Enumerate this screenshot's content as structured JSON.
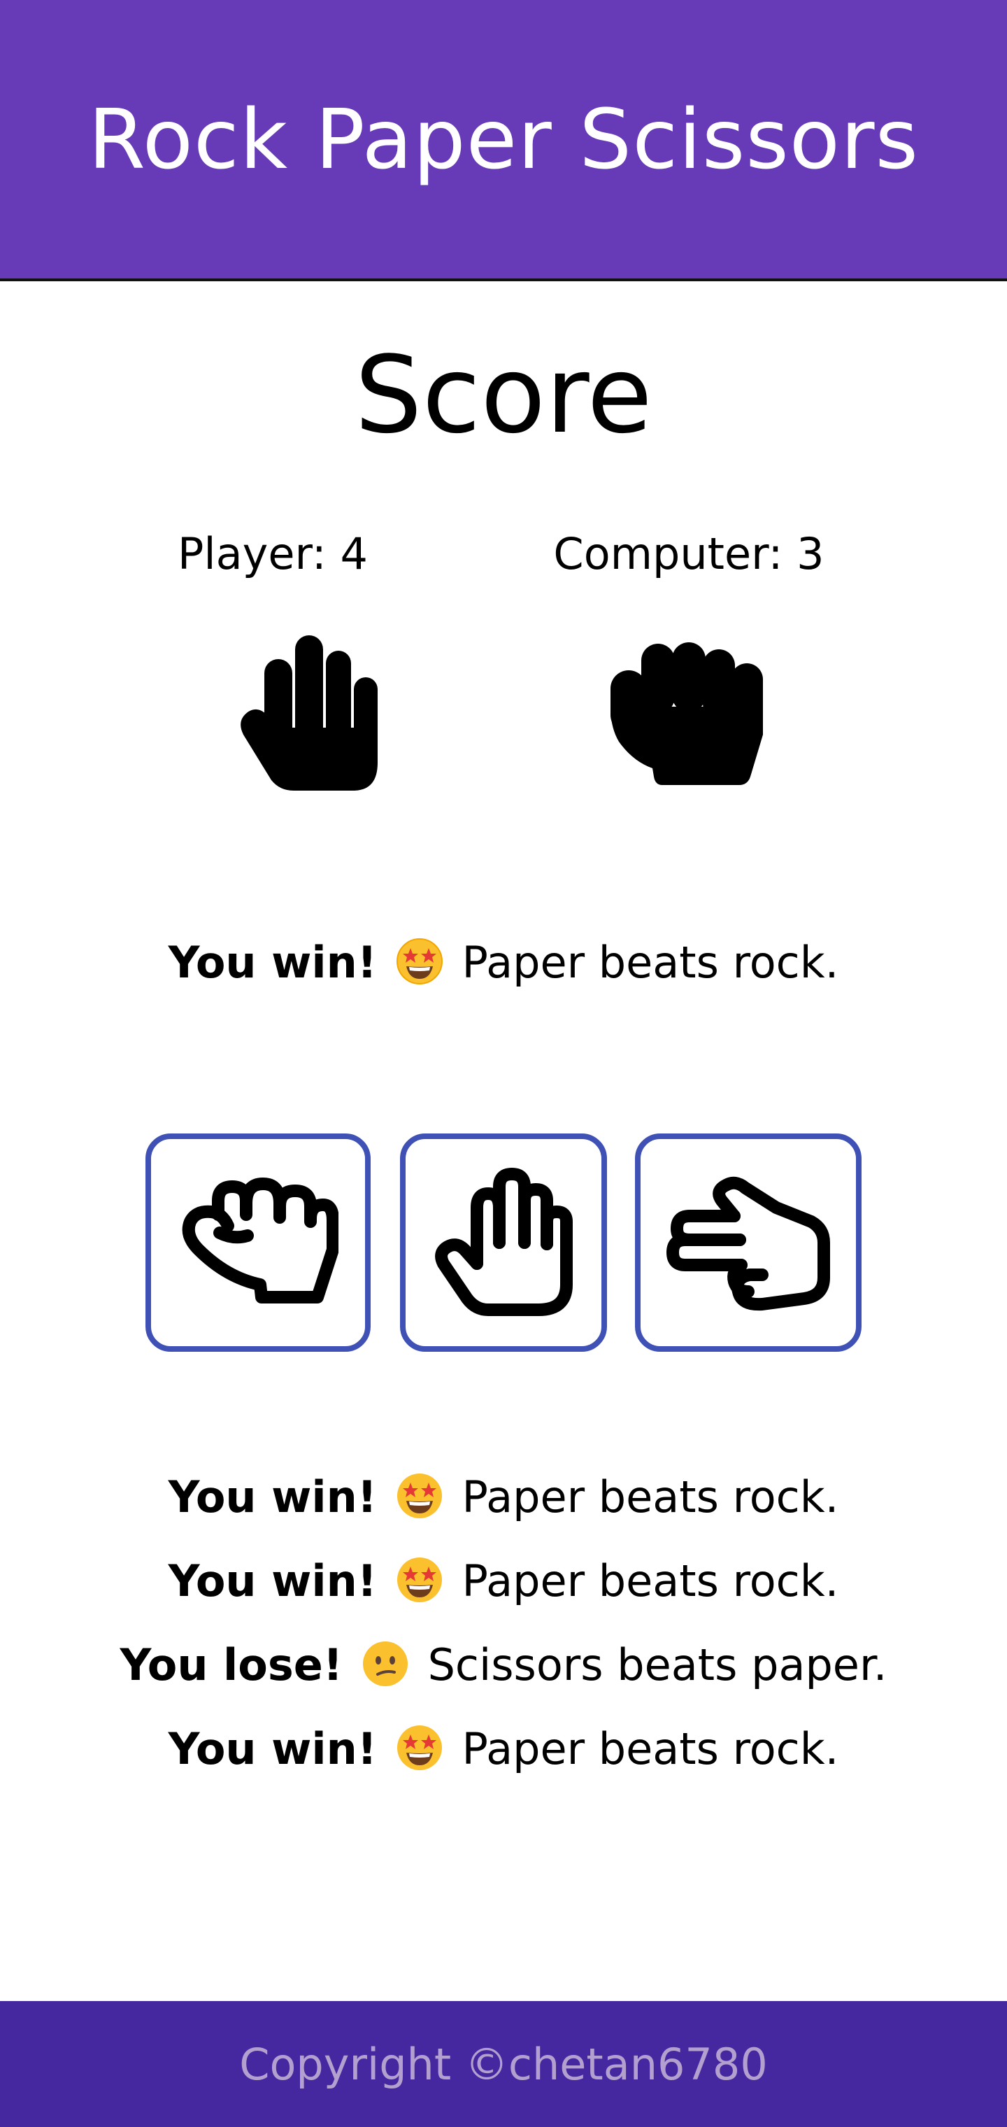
{
  "header": {
    "title": "Rock Paper Scissors"
  },
  "score": {
    "title": "Score",
    "player_label": "Player: 4",
    "computer_label": "Computer: 3",
    "player_choice_icon": "paper-hand-icon",
    "computer_choice_icon": "rock-fist-icon"
  },
  "round_result": {
    "prefix": "You win!",
    "emoji": "star-struck-emoji",
    "text": "Paper beats rock."
  },
  "buttons": [
    {
      "name": "rock",
      "icon": "fist-outline-icon"
    },
    {
      "name": "paper",
      "icon": "hand-outline-icon"
    },
    {
      "name": "scissors",
      "icon": "scissors-hand-outline-icon"
    }
  ],
  "history": [
    {
      "prefix": "You win!",
      "emoji": "star-struck-emoji",
      "text": "Paper beats rock."
    },
    {
      "prefix": "You win!",
      "emoji": "star-struck-emoji",
      "text": "Paper beats rock."
    },
    {
      "prefix": "You lose!",
      "emoji": "confused-face-emoji",
      "text": "Scissors beats paper."
    },
    {
      "prefix": "You win!",
      "emoji": "star-struck-emoji",
      "text": "Paper beats rock."
    }
  ],
  "footer": {
    "copyright": "Copyright ©chetan6780"
  },
  "colors": {
    "header_bg": "#673ab7",
    "footer_bg": "#4527a0",
    "footer_text": "#b3a0cf",
    "button_border": "#3f51b5"
  }
}
